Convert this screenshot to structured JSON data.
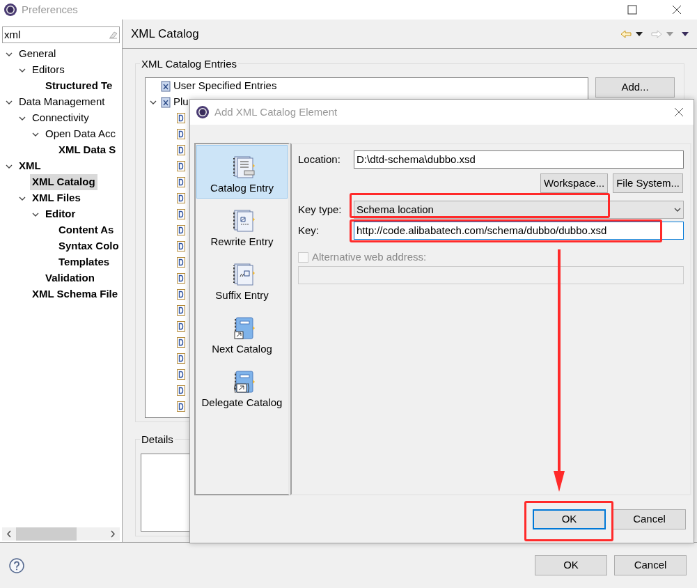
{
  "window": {
    "title": "Preferences"
  },
  "filter": {
    "value": "xml"
  },
  "tree": [
    {
      "label": "General",
      "expanded": true,
      "matched": false,
      "selected": false,
      "children": [
        {
          "label": "Editors",
          "expanded": true,
          "matched": false,
          "selected": false,
          "children": [
            {
              "label": "Structured Te",
              "matched": true,
              "selected": false
            }
          ]
        }
      ]
    },
    {
      "label": "Data Management",
      "expanded": true,
      "matched": false,
      "selected": false,
      "children": [
        {
          "label": "Connectivity",
          "expanded": true,
          "matched": false,
          "selected": false,
          "children": [
            {
              "label": "Open Data Acc",
              "expanded": true,
              "matched": false,
              "selected": false,
              "children": [
                {
                  "label": "XML Data S",
                  "matched": true,
                  "selected": false
                }
              ]
            }
          ]
        }
      ]
    },
    {
      "label": "XML",
      "expanded": true,
      "matched": true,
      "selected": false,
      "children": [
        {
          "label": "XML Catalog",
          "matched": true,
          "selected": true
        },
        {
          "label": "XML Files",
          "expanded": true,
          "matched": true,
          "selected": false,
          "children": [
            {
              "label": "Editor",
              "expanded": true,
              "matched": true,
              "selected": false,
              "children": [
                {
                  "label": "Content As",
                  "matched": true,
                  "selected": false
                },
                {
                  "label": "Syntax Colo",
                  "matched": true,
                  "selected": false
                },
                {
                  "label": "Templates",
                  "matched": true,
                  "selected": false
                }
              ]
            },
            {
              "label": "Validation",
              "matched": true,
              "selected": false
            }
          ]
        },
        {
          "label": "XML Schema File",
          "matched": true,
          "selected": false
        }
      ]
    }
  ],
  "page": {
    "title": "XML Catalog"
  },
  "entries_group": {
    "title": "XML Catalog Entries",
    "items": [
      {
        "label": "User Specified Entries"
      },
      {
        "label": "Plu",
        "expanded": true
      }
    ],
    "add_button": "Add..."
  },
  "details": {
    "title": "Details"
  },
  "buttons": [
    {
      "label": "OK",
      "default": false
    },
    {
      "label": "Cancel",
      "default": false
    }
  ],
  "dialog": {
    "title": "Add XML Catalog Element",
    "types": [
      {
        "label": "Catalog Entry",
        "kind": "catalog",
        "selected": true
      },
      {
        "label": "Rewrite Entry",
        "kind": "rewrite",
        "selected": false
      },
      {
        "label": "Suffix Entry",
        "kind": "suffix",
        "selected": false
      },
      {
        "label": "Next Catalog",
        "kind": "next",
        "selected": false
      },
      {
        "label": "Delegate Catalog",
        "kind": "delegate",
        "selected": false
      }
    ],
    "location": {
      "label": "Location:",
      "value": "D:\\dtd-schema\\dubbo.xsd"
    },
    "browse_buttons": [
      "Workspace...",
      "File System..."
    ],
    "key_type": {
      "label": "Key type:",
      "value": "Schema location"
    },
    "key": {
      "label": "Key:",
      "value": "http://code.alibabatech.com/schema/dubbo/dubbo.xsd",
      "focused": true
    },
    "alternative": {
      "label": "Alternative web address:",
      "checked": false,
      "disabled": true
    },
    "buttons": [
      {
        "label": "OK",
        "default": true
      },
      {
        "label": "Cancel",
        "default": false
      }
    ]
  }
}
